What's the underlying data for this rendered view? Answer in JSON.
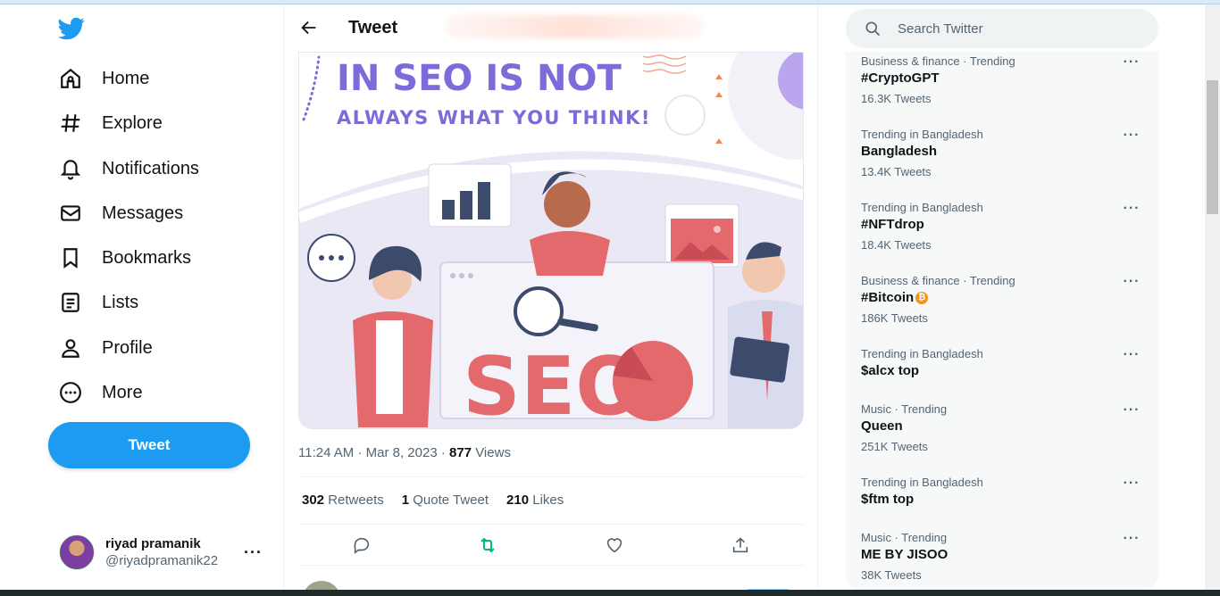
{
  "nav": {
    "items": [
      {
        "label": "Home",
        "icon": "home-icon"
      },
      {
        "label": "Explore",
        "icon": "hashtag-icon"
      },
      {
        "label": "Notifications",
        "icon": "bell-icon"
      },
      {
        "label": "Messages",
        "icon": "envelope-icon"
      },
      {
        "label": "Bookmarks",
        "icon": "bookmark-icon"
      },
      {
        "label": "Lists",
        "icon": "list-icon"
      },
      {
        "label": "Profile",
        "icon": "person-icon"
      },
      {
        "label": "More",
        "icon": "more-circle-icon"
      }
    ],
    "tweet_button": "Tweet"
  },
  "account": {
    "name": "riyad pramanik",
    "handle": "@riyadpramanik22",
    "more": "···"
  },
  "main": {
    "title": "Tweet",
    "image": {
      "headline_line1": "IN SEO IS NOT",
      "headline_line2": "ALWAYS WHAT YOU THINK!",
      "big_word": "SEO"
    },
    "meta": {
      "time": "11:24 AM",
      "date": "Mar 8, 2023",
      "views_count": "877",
      "views_label": "Views"
    },
    "stats": {
      "retweets_count": "302",
      "retweets_label": "Retweets",
      "quotes_count": "1",
      "quotes_label": "Quote Tweet",
      "likes_count": "210",
      "likes_label": "Likes"
    }
  },
  "search": {
    "placeholder": "Search Twitter"
  },
  "trends": [
    {
      "category": "Business & finance · Trending",
      "name": "#CryptoGPT",
      "count": "16.3K Tweets"
    },
    {
      "category": "Trending in Bangladesh",
      "name": "Bangladesh",
      "count": "13.4K Tweets"
    },
    {
      "category": "Trending in Bangladesh",
      "name": "#NFTdrop",
      "count": "18.4K Tweets"
    },
    {
      "category": "Business & finance · Trending",
      "name": "#Bitcoin",
      "count": "186K Tweets"
    },
    {
      "category": "Trending in Bangladesh",
      "name": "$alcx top",
      "count": ""
    },
    {
      "category": "Music · Trending",
      "name": "Queen",
      "count": "251K Tweets"
    },
    {
      "category": "Trending in Bangladesh",
      "name": "$ftm top",
      "count": ""
    },
    {
      "category": "Music · Trending",
      "name": "ME BY JISOO",
      "count": "38K Tweets"
    }
  ],
  "trend_more": "···",
  "colors": {
    "brand": "#1d9bf0",
    "retweet_active": "#00ba7c",
    "headline_purple": "#7b6cd9",
    "seo_red": "#e3696d"
  }
}
